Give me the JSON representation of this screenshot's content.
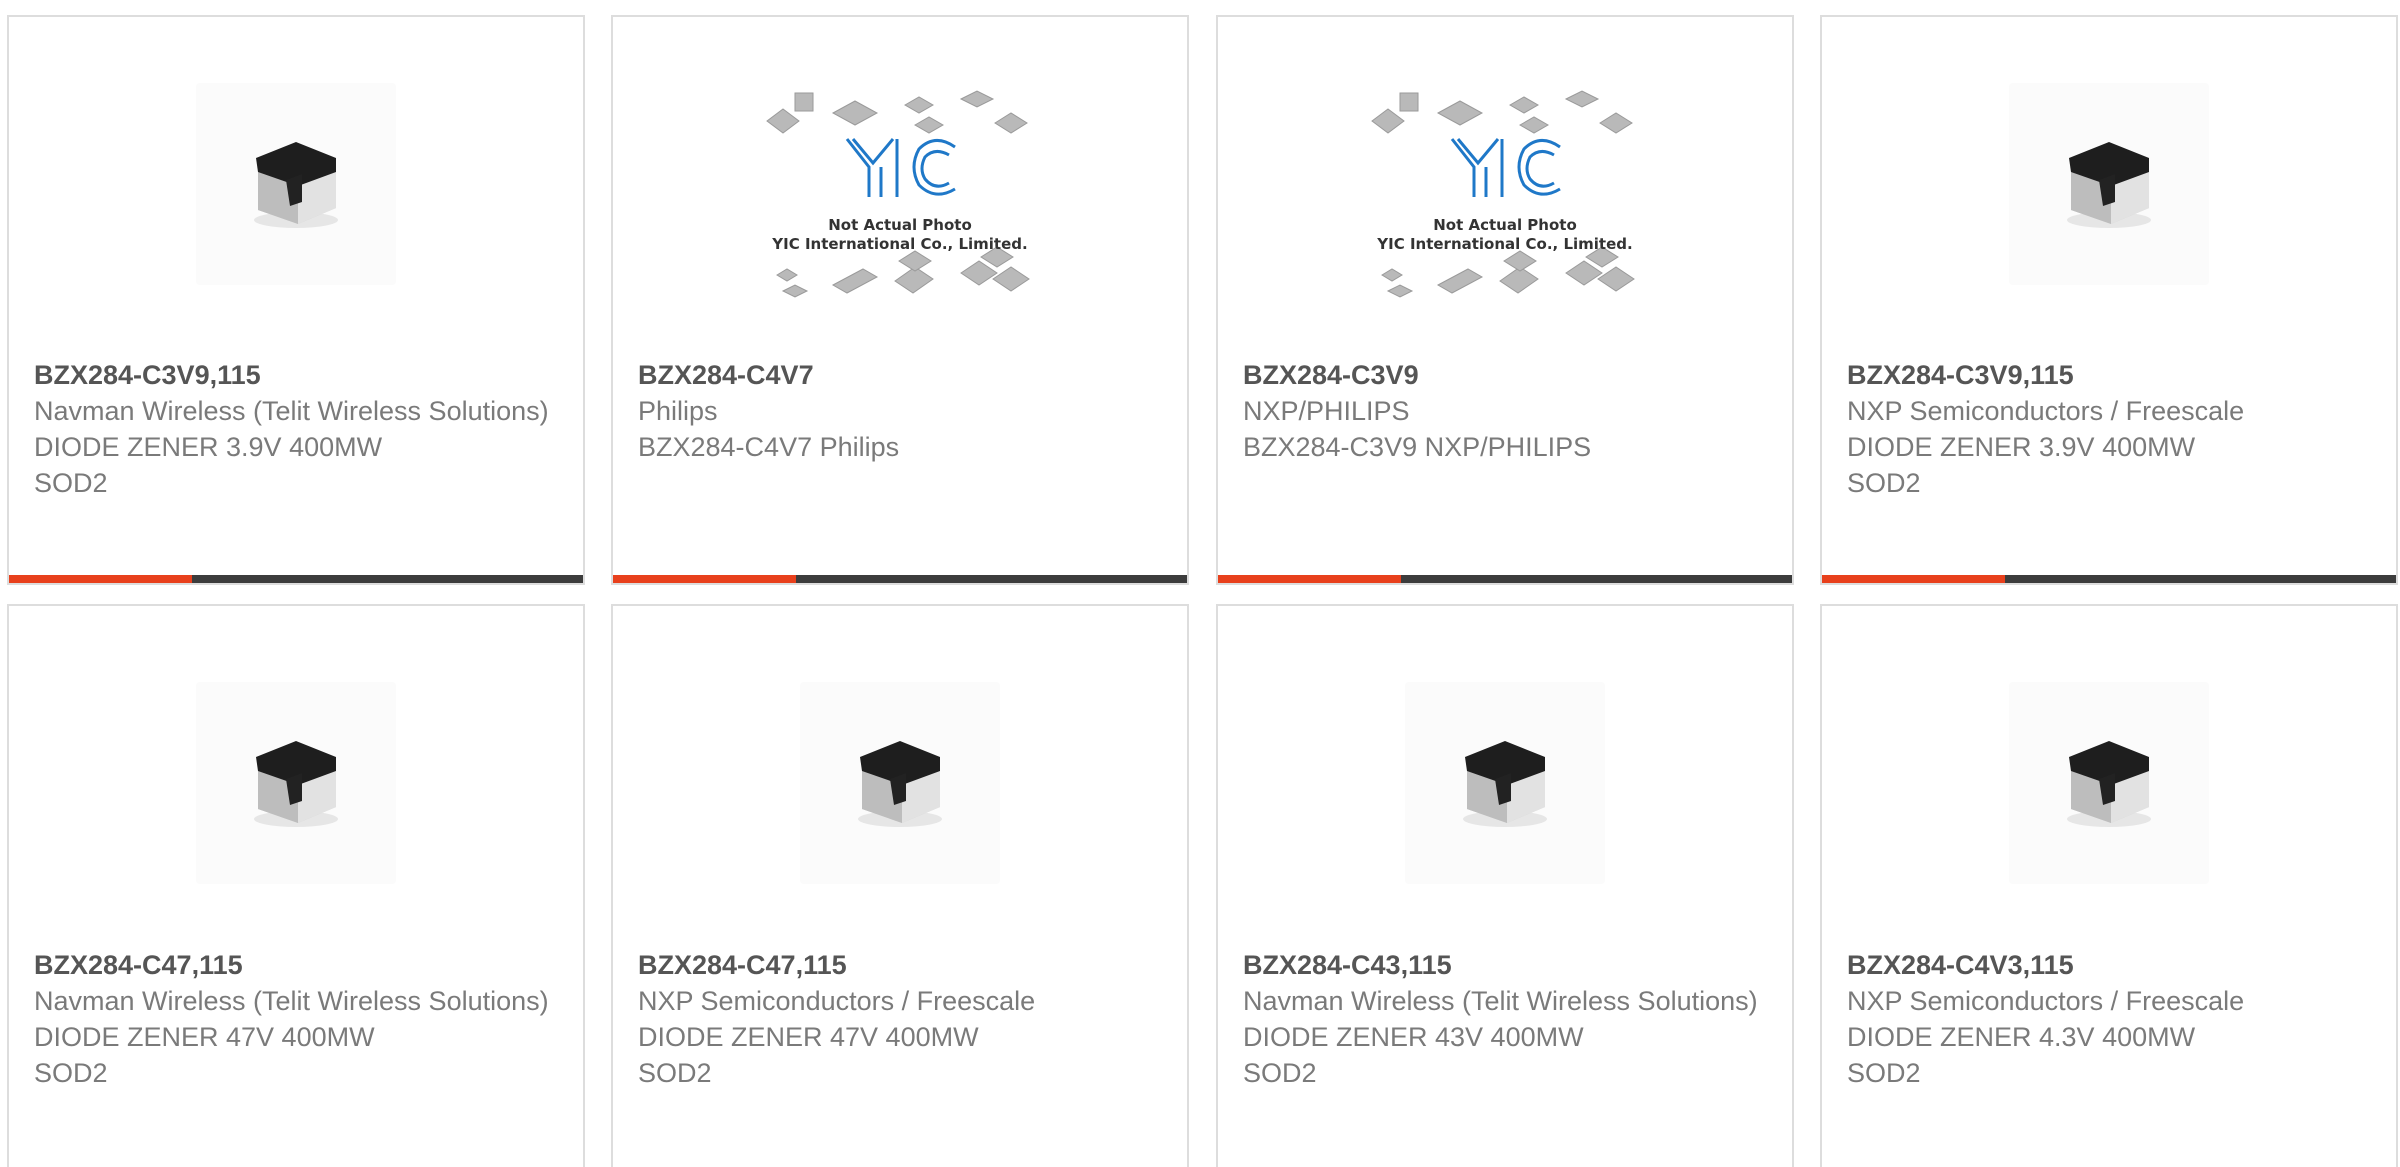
{
  "colors": {
    "accent": "#e8401c",
    "bar_dark": "#3c3c3c",
    "part_text": "#555555",
    "body_text": "#7a7a7a",
    "yic_logo": "#1f78c8"
  },
  "placeholder_image": {
    "line1": "Not Actual Photo",
    "line2": "YIC International Co., Limited.",
    "logo_text": "YIC"
  },
  "products": [
    {
      "part_number": "BZX284-C3V9,115",
      "manufacturer": "Navman Wireless (Telit Wireless Solutions)",
      "description": "DIODE ZENER 3.9V 400MW",
      "package": "SOD2",
      "image": "diode-chip-icon"
    },
    {
      "part_number": "BZX284-C4V7",
      "manufacturer": "Philips",
      "description": "BZX284-C4V7 Philips",
      "package": "",
      "image": "yic-placeholder"
    },
    {
      "part_number": "BZX284-C3V9",
      "manufacturer": "NXP/PHILIPS",
      "description": "BZX284-C3V9 NXP/PHILIPS",
      "package": "",
      "image": "yic-placeholder"
    },
    {
      "part_number": "BZX284-C3V9,115",
      "manufacturer": "NXP Semiconductors / Freescale",
      "description": "DIODE ZENER 3.9V 400MW",
      "package": "SOD2",
      "image": "diode-chip-icon"
    },
    {
      "part_number": "BZX284-C47,115",
      "manufacturer": "Navman Wireless (Telit Wireless Solutions)",
      "description": "DIODE ZENER 47V 400MW",
      "package": "SOD2",
      "image": "diode-chip-icon"
    },
    {
      "part_number": "BZX284-C47,115",
      "manufacturer": "NXP Semiconductors / Freescale",
      "description": "DIODE ZENER 47V 400MW",
      "package": "SOD2",
      "image": "diode-chip-icon"
    },
    {
      "part_number": "BZX284-C43,115",
      "manufacturer": "Navman Wireless (Telit Wireless Solutions)",
      "description": "DIODE ZENER 43V 400MW",
      "package": "SOD2",
      "image": "diode-chip-icon"
    },
    {
      "part_number": "BZX284-C4V3,115",
      "manufacturer": "NXP Semiconductors / Freescale",
      "description": "DIODE ZENER 4.3V 400MW",
      "package": "SOD2",
      "image": "diode-chip-icon"
    }
  ]
}
